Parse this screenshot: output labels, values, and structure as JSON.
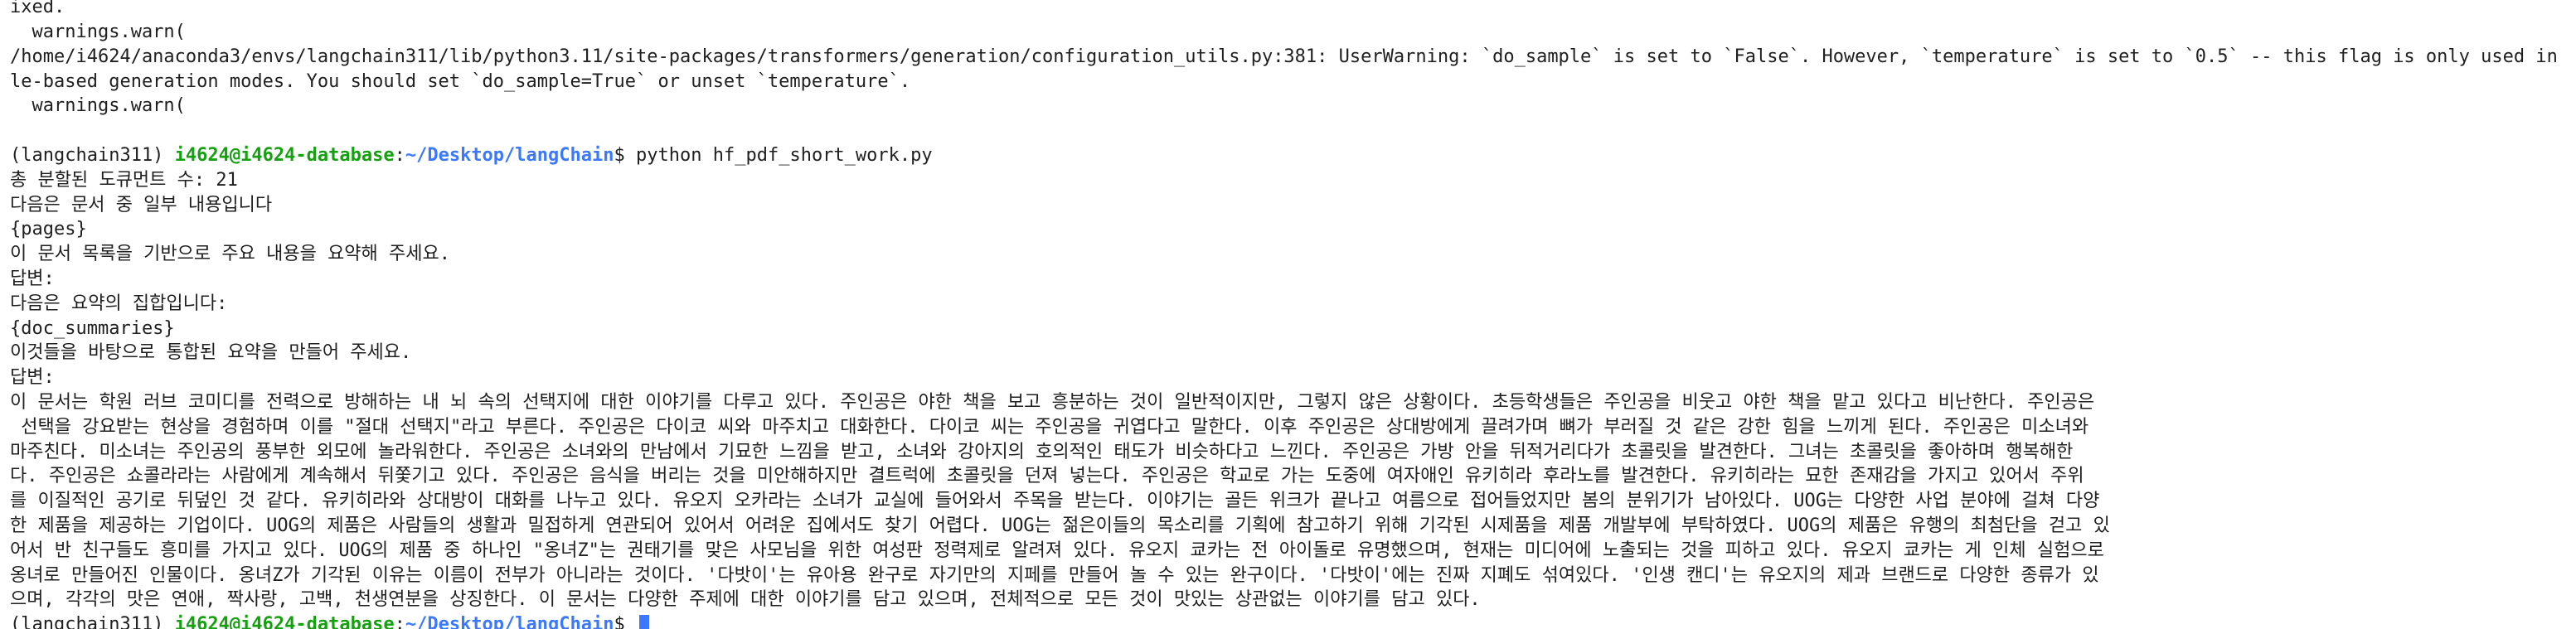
{
  "terminal": {
    "top_lines": [
      "ixed.",
      "  warnings.warn(",
      "/home/i4624/anaconda3/envs/langchain311/lib/python3.11/site-packages/transformers/generation/configuration_utils.py:381: UserWarning: `do_sample` is set to `False`. However, `temperature` is set to `0.5` -- this flag is only used in samp",
      "le-based generation modes. You should set `do_sample=True` or unset `temperature`.",
      "  warnings.warn("
    ],
    "prompt_1": {
      "env": "(langchain311) ",
      "userhost": "i4624@i4624-database",
      "sep": ":",
      "path": "~/Desktop/langChain",
      "dollar": "$ ",
      "command": "python hf_pdf_short_work.py"
    },
    "output_lines": [
      "총 분할된 도큐먼트 수: 21",
      "다음은 문서 중 일부 내용입니다",
      "{pages}",
      "이 문서 목록을 기반으로 주요 내용을 요약해 주세요.",
      "답변:",
      "다음은 요약의 집합입니다:",
      "{doc_summaries}",
      "이것들을 바탕으로 통합된 요약을 만들어 주세요.",
      "답변:",
      "이 문서는 학원 러브 코미디를 전력으로 방해하는 내 뇌 속의 선택지에 대한 이야기를 다루고 있다. 주인공은 야한 책을 보고 흥분하는 것이 일반적이지만, 그렇지 않은 상황이다. 초등학생들은 주인공을 비웃고 야한 책을 맡고 있다고 비난한다. 주인공은",
      " 선택을 강요받는 현상을 경험하며 이를 \"절대 선택지\"라고 부른다. 주인공은 다이코 씨와 마주치고 대화한다. 다이코 씨는 주인공을 귀엽다고 말한다. 이후 주인공은 상대방에게 끌려가며 뼈가 부러질 것 같은 강한 힘을 느끼게 된다. 주인공은 미소녀와",
      "마주친다. 미소녀는 주인공의 풍부한 외모에 놀라워한다. 주인공은 소녀와의 만남에서 기묘한 느낌을 받고, 소녀와 강아지의 호의적인 태도가 비슷하다고 느낀다. 주인공은 가방 안을 뒤적거리다가 초콜릿을 발견한다. 그녀는 초콜릿을 좋아하며 행복해한",
      "다. 주인공은 쇼콜라라는 사람에게 계속해서 뒤쫓기고 있다. 주인공은 음식을 버리는 것을 미안해하지만 결트럭에 초콜릿을 던져 넣는다. 주인공은 학교로 가는 도중에 여자애인 유키히라 후라노를 발견한다. 유키히라는 묘한 존재감을 가지고 있어서 주위",
      "를 이질적인 공기로 뒤덮인 것 같다. 유키히라와 상대방이 대화를 나누고 있다. 유오지 오카라는 소녀가 교실에 들어와서 주목을 받는다. 이야기는 골든 위크가 끝나고 여름으로 접어들었지만 봄의 분위기가 남아있다. UOG는 다양한 사업 분야에 걸쳐 다양",
      "한 제품을 제공하는 기업이다. UOG의 제품은 사람들의 생활과 밀접하게 연관되어 있어서 어려운 집에서도 찾기 어렵다. UOG는 젊은이들의 목소리를 기획에 참고하기 위해 기각된 시제품을 제품 개발부에 부탁하였다. UOG의 제품은 유행의 최첨단을 걷고 있",
      "어서 반 친구들도 흥미를 가지고 있다. UOG의 제품 중 하나인 \"옹녀Z\"는 권태기를 맞은 사모님을 위한 여성판 정력제로 알려져 있다. 유오지 쿄카는 전 아이돌로 유명했으며, 현재는 미디어에 노출되는 것을 피하고 있다. 유오지 쿄카는 게 인체 실험으로",
      "옹녀로 만들어진 인물이다. 옹녀Z가 기각된 이유는 이름이 전부가 아니라는 것이다. '다밧이'는 유아용 완구로 자기만의 지페를 만들어 놀 수 있는 완구이다. '다밧이'에는 진짜 지폐도 섞여있다. '인생 캔디'는 유오지의 제과 브랜드로 다양한 종류가 있",
      "으며, 각각의 맛은 연애, 짝사랑, 고백, 천생연분을 상징한다. 이 문서는 다양한 주제에 대한 이야기를 담고 있으며, 전체적으로 모든 것이 맛있는 상관없는 이야기를 담고 있다."
    ],
    "prompt_2": {
      "env": "(langchain311) ",
      "userhost": "i4624@i4624-database",
      "sep": ":",
      "path": "~/Desktop/langChain",
      "dollar": "$ "
    }
  }
}
